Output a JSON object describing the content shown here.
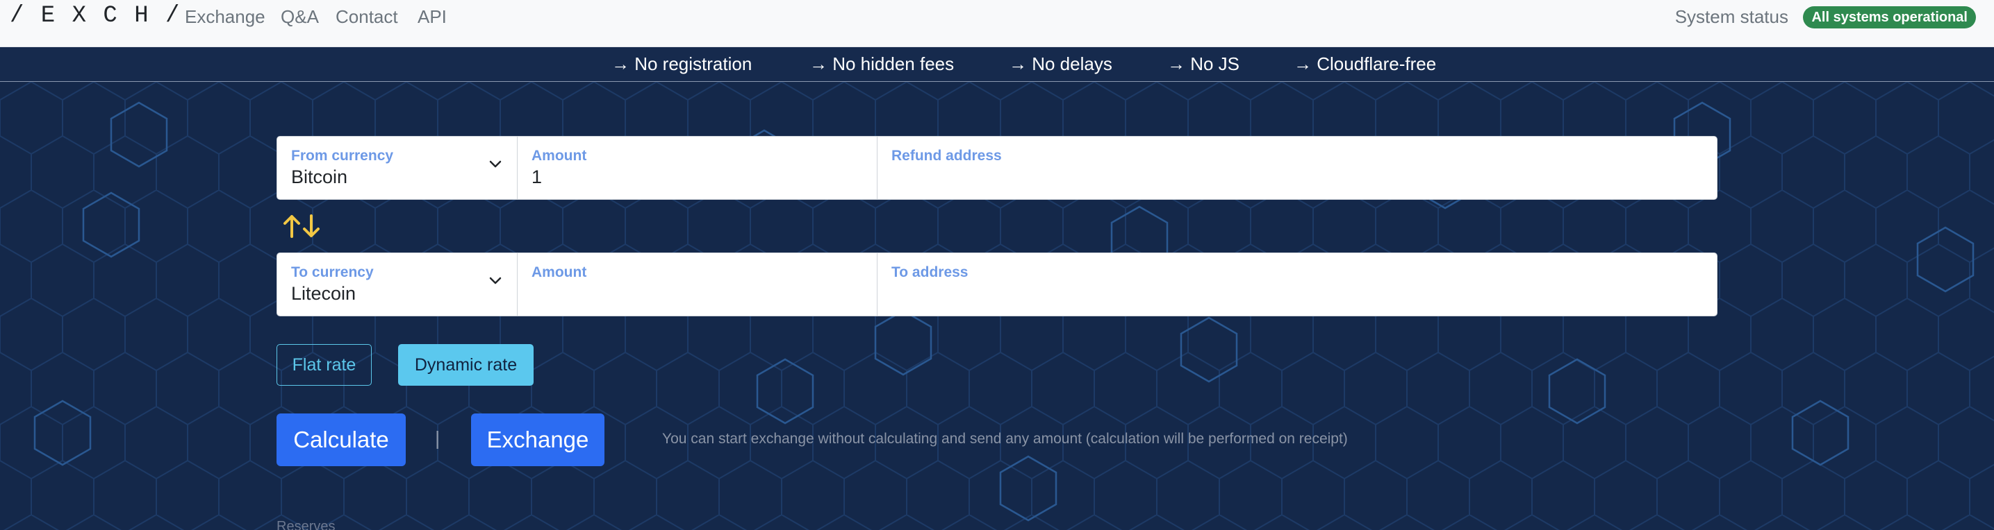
{
  "nav": {
    "logo": "/ E X C H /",
    "links": [
      "Exchange",
      "Q&A",
      "Contact",
      "API"
    ],
    "system_status_label": "System status",
    "system_status_badge": "All systems operational",
    "badge_color": "#2f8a4f"
  },
  "features": [
    "→ No registration",
    "→ No hidden fees",
    "→ No delays",
    "→ No JS",
    "→ Cloudflare-free"
  ],
  "form": {
    "from_currency": {
      "label": "From currency",
      "value": "Bitcoin"
    },
    "from_amount": {
      "label": "Amount",
      "value": "1"
    },
    "refund_address": {
      "label": "Refund address",
      "value": ""
    },
    "swap_icon": "⇅",
    "to_currency": {
      "label": "To currency",
      "value": "Litecoin"
    },
    "to_amount": {
      "label": "Amount",
      "value": ""
    },
    "to_address": {
      "label": "To address",
      "value": ""
    }
  },
  "rates": {
    "flat": "Flat rate",
    "dynamic": "Dynamic rate",
    "selected": "dynamic"
  },
  "actions": {
    "calculate": "Calculate",
    "separator": "|",
    "exchange": "Exchange",
    "hint": "You can start exchange without calculating and send any amount (calculation will be performed on receipt)"
  },
  "footer": {
    "reserves_label": "Reserves"
  },
  "colors": {
    "background": "#14284a",
    "label_blue": "#6d99e6",
    "accent_cyan": "#5bc8ee",
    "button_blue": "#2c6cf2",
    "swap_yellow": "#f2c744"
  }
}
